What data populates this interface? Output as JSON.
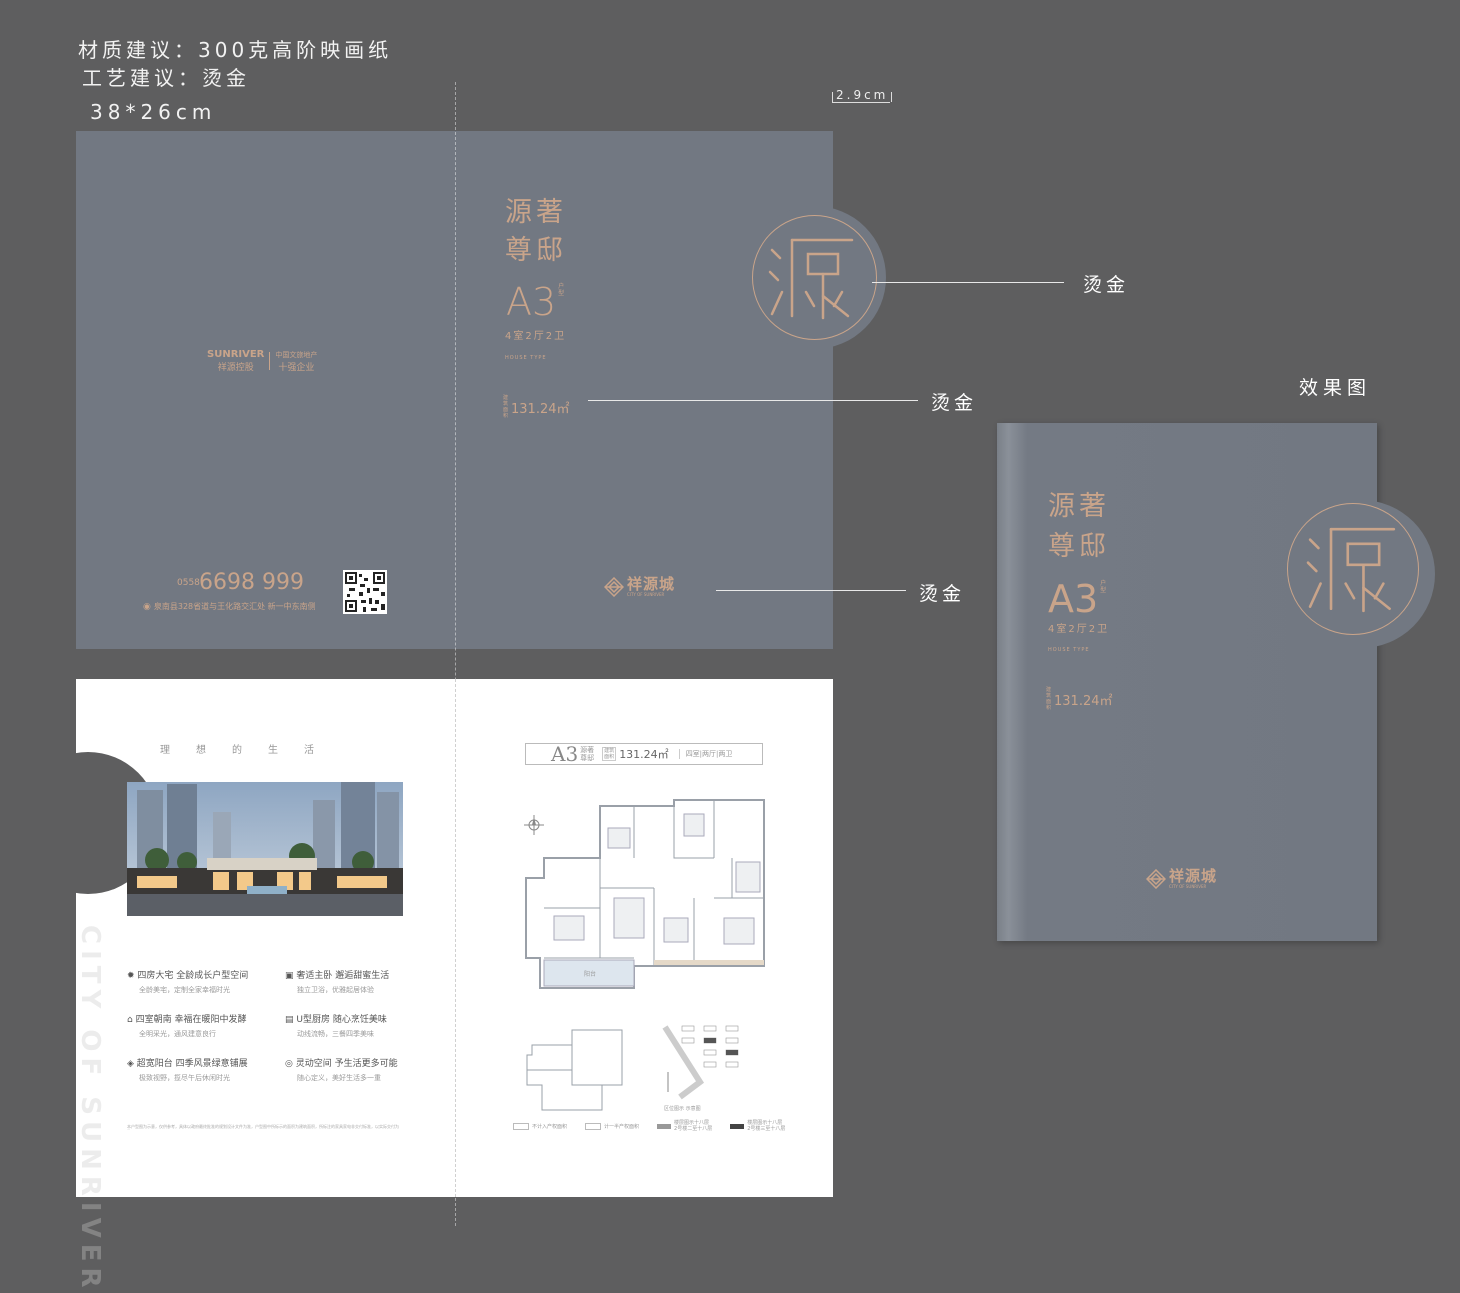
{
  "specs": {
    "material": "材质建议：300克高阶映画纸",
    "craft": "工艺建议：烫金",
    "size": "38*26cm"
  },
  "dimension_label": "2.9cm",
  "preview_label": "效果图",
  "callouts": [
    "烫金",
    "烫金",
    "烫金"
  ],
  "cover": {
    "title_line1": "源著",
    "title_line2": "尊邸",
    "unit_type": "A3",
    "unit_suffix": "户型",
    "layout": "4室2厅2卫",
    "house_type": "HOUSE TYPE",
    "area_label": "建筑面积",
    "area": "131.24㎡",
    "seal_char": "源",
    "brand_name": "祥源城",
    "brand_en": "CITY OF SUNRIVER"
  },
  "back_cover": {
    "logo_en": "SUNRIVER",
    "logo_cn": "祥源控股",
    "logo_tag1": "中国文旅地产",
    "logo_tag2": "十强企业",
    "phone_prefix": "0558",
    "phone": "6698 999",
    "address": "泉南县328省道与王化路交汇处 新一中东南侧"
  },
  "inner_left": {
    "heading": "理　　想　　的　　生　　活",
    "vertical_text": "CITY OF SUNRIVER",
    "features": [
      {
        "icon": "sun-icon",
        "title": "四房大宅 全龄成长户型空间",
        "sub": "全龄美宅，定制全家幸福时光"
      },
      {
        "icon": "bed-icon",
        "title": "奢适主卧 邂逅甜蜜生活",
        "sub": "独立卫浴，优雅起居体验"
      },
      {
        "icon": "house-icon",
        "title": "四室朝南 幸福在暖阳中发酵",
        "sub": "全明采光，通风建意良行"
      },
      {
        "icon": "kitchen-icon",
        "title": "U型厨房 随心烹饪美味",
        "sub": "动线流畅，三餐四季美味"
      },
      {
        "icon": "balcony-icon",
        "title": "超宽阳台 四季风景绿意铺展",
        "sub": "极致视野，揽尽午后休闲时光"
      },
      {
        "icon": "space-icon",
        "title": "灵动空间 予生活更多可能",
        "sub": "随心定义，美好生活多一重"
      }
    ],
    "disclaimer": "本户型图为示意，仅供参考，具体以政府最终批准的规划设计文件为准，户型图中所标示的面积为建筑面积，所标注的家具家电非交付标准，以实际交付为准。"
  },
  "inner_right": {
    "unit": "A3",
    "name_line1": "源著",
    "name_line2": "尊邸",
    "area_label1": "建筑",
    "area_label2": "面积",
    "area": "131.24㎡",
    "rooms": "四室|两厅|两卫",
    "balcony_label": "阳台",
    "legend": [
      {
        "label": "不计入产权面积"
      },
      {
        "label": "计一半产权面积"
      },
      {
        "label": "楼层图示十八层\n2号楼二至十八层"
      },
      {
        "label": "楼层图示十八层\n2号楼三至十八层"
      }
    ],
    "site_label": "区位图示 示意图"
  }
}
